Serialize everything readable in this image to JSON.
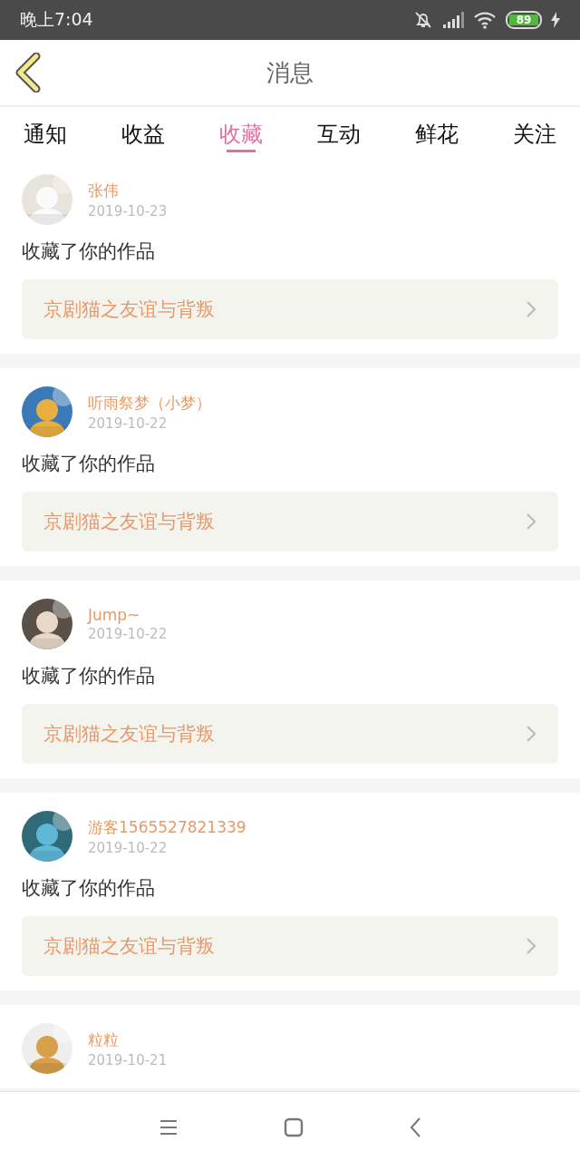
{
  "status_bar": {
    "time": "晚上7:04",
    "battery": "89"
  },
  "header": {
    "title": "消息"
  },
  "tabs": [
    {
      "label": "通知",
      "selected": false
    },
    {
      "label": "收益",
      "selected": false
    },
    {
      "label": "收藏",
      "selected": true
    },
    {
      "label": "互动",
      "selected": false
    },
    {
      "label": "鲜花",
      "selected": false
    },
    {
      "label": "关注",
      "selected": false
    }
  ],
  "messages": [
    {
      "name": "张伟",
      "date": "2019-10-23",
      "text": "收藏了你的作品",
      "work": "京剧猫之友谊与背叛"
    },
    {
      "name": "听雨祭梦（小梦）",
      "date": "2019-10-22",
      "text": "收藏了你的作品",
      "work": "京剧猫之友谊与背叛"
    },
    {
      "name": "Jump~",
      "date": "2019-10-22",
      "text": "收藏了你的作品",
      "work": "京剧猫之友谊与背叛"
    },
    {
      "name": "游客1565527821339",
      "date": "2019-10-22",
      "text": "收藏了你的作品",
      "work": "京剧猫之友谊与背叛"
    },
    {
      "name": "粒粒",
      "date": "2019-10-21"
    }
  ]
}
